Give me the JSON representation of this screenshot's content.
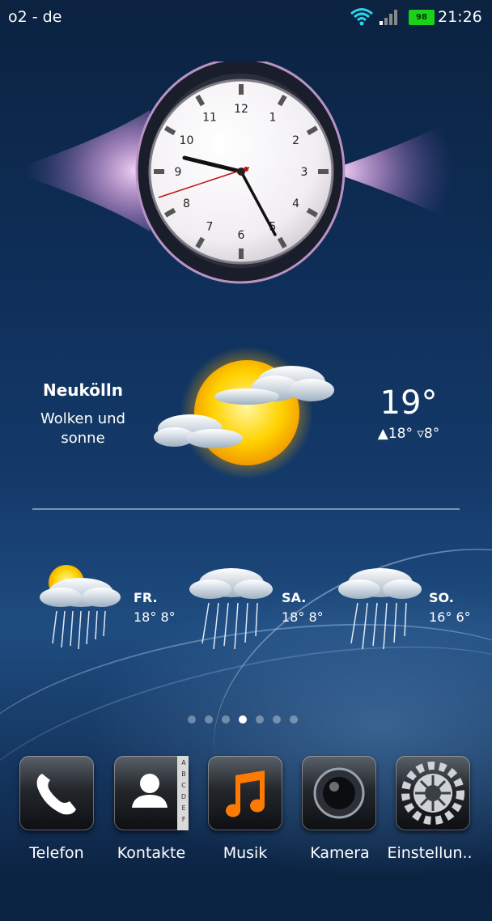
{
  "status_bar": {
    "carrier": "o2 - de",
    "battery_level": "98",
    "time": "21:26"
  },
  "clock": {
    "numerals": [
      "12",
      "1",
      "2",
      "3",
      "4",
      "5",
      "6",
      "7",
      "8",
      "9",
      "10",
      "11"
    ],
    "time_shown": "21:26"
  },
  "weather": {
    "city": "Neukölln",
    "description_line1": "Wolken und",
    "description_line2": "sonne",
    "temperature": "19°",
    "minmax": "▲18° ▿8°"
  },
  "forecast": [
    {
      "day": "FR.",
      "temps": "18° 8°",
      "icon": "sun-cloud-rain-icon"
    },
    {
      "day": "SA.",
      "temps": "18° 8°",
      "icon": "cloud-rain-icon"
    },
    {
      "day": "SO.",
      "temps": "16° 6°",
      "icon": "cloud-rain-icon"
    }
  ],
  "page_indicator": {
    "count": 7,
    "active": 3
  },
  "dock": [
    {
      "label": "Telefon",
      "icon": "phone-icon"
    },
    {
      "label": "Kontakte",
      "icon": "contacts-icon"
    },
    {
      "label": "Musik",
      "icon": "music-note-icon"
    },
    {
      "label": "Kamera",
      "icon": "camera-icon"
    },
    {
      "label": "Einstellun..",
      "icon": "settings-gear-icon"
    }
  ],
  "contacts_index_letters": [
    "A",
    "B",
    "C",
    "D",
    "E",
    "F"
  ],
  "colors": {
    "battery": "#19d219",
    "accent_orange": "#ff7a00"
  }
}
